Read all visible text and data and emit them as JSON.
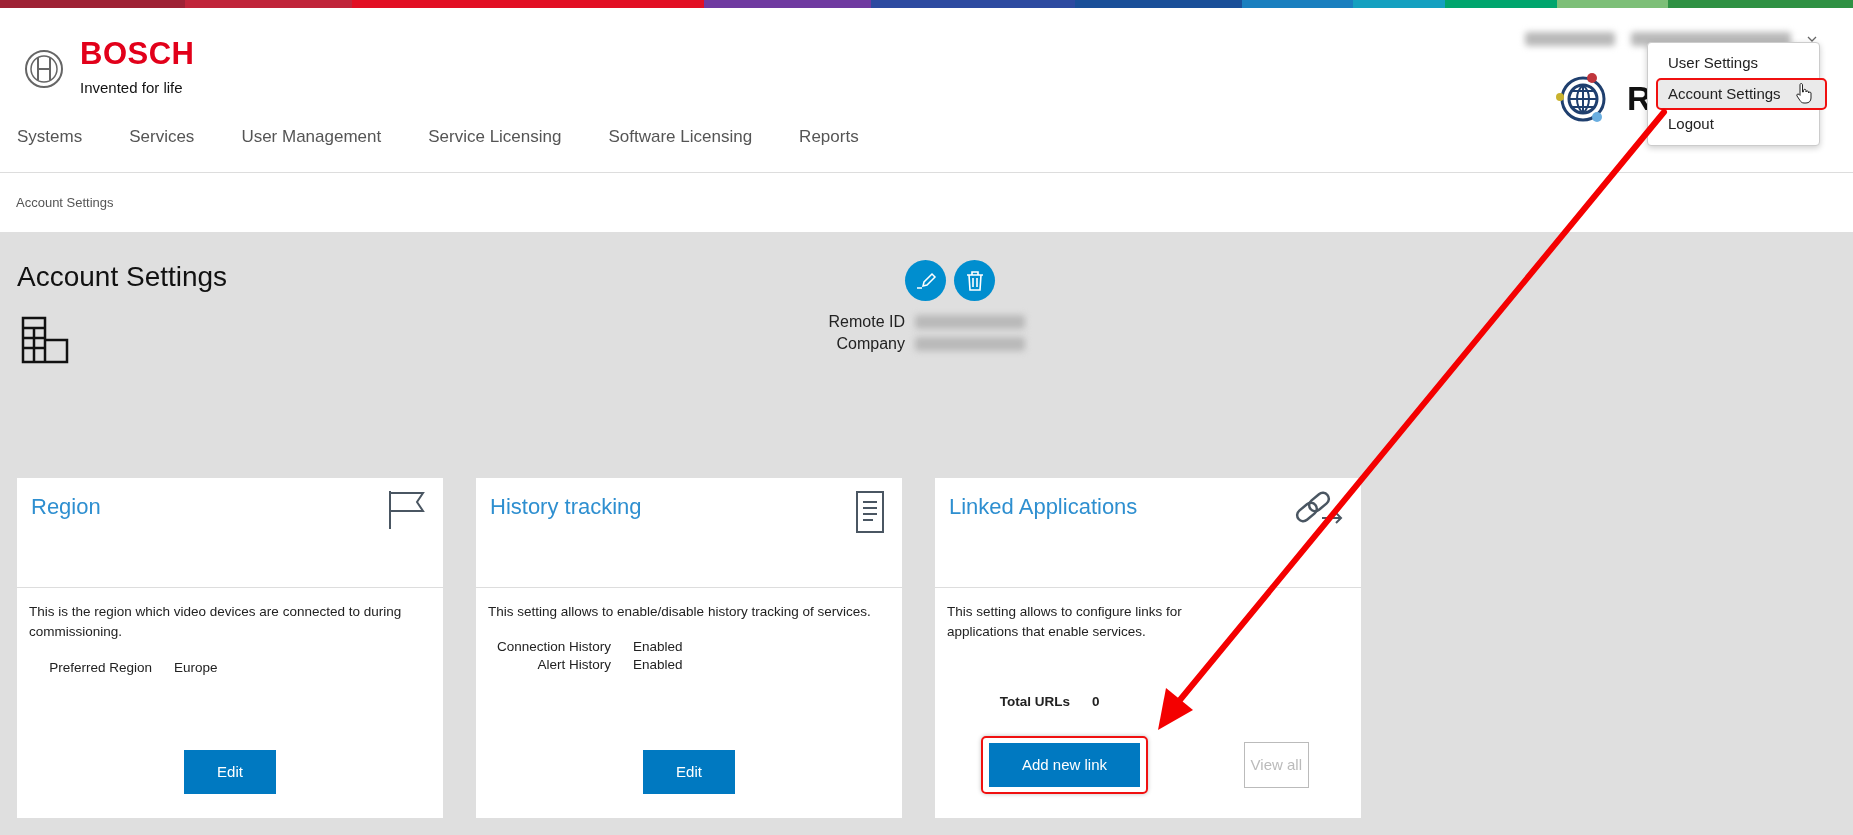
{
  "brand": {
    "name": "BOSCH",
    "tagline": "Invented for life"
  },
  "account_bar": {
    "redacted": true,
    "expanded": true
  },
  "app_logo": {
    "text": "R"
  },
  "user_menu": {
    "items": [
      {
        "label": "User Settings",
        "hovered": false,
        "highlighted": false
      },
      {
        "label": "Account Settings",
        "hovered": true,
        "highlighted": true
      },
      {
        "label": "Logout",
        "hovered": false,
        "highlighted": false
      }
    ]
  },
  "nav": [
    {
      "label": "Systems"
    },
    {
      "label": "Services"
    },
    {
      "label": "User Management"
    },
    {
      "label": "Service Licensing"
    },
    {
      "label": "Software Licensing"
    },
    {
      "label": "Reports"
    }
  ],
  "breadcrumb": [
    "Account Settings"
  ],
  "page": {
    "title": "Account Settings",
    "fields": [
      {
        "label": "Remote ID",
        "redacted": true
      },
      {
        "label": "Company",
        "redacted": true
      }
    ]
  },
  "cards": [
    {
      "title": "Region",
      "kind": "setting",
      "description": "This is the region which video devices are connected to during commissioning.",
      "rows": [
        {
          "label": "Preferred Region",
          "value": "Europe"
        }
      ],
      "buttons": [
        {
          "label": "Edit",
          "disabled": false,
          "highlighted": false
        }
      ]
    },
    {
      "title": "History tracking",
      "kind": "setting",
      "description": "This setting allows to enable/disable history tracking of services.",
      "rows": [
        {
          "label": "Connection History",
          "value": "Enabled"
        },
        {
          "label": "Alert History",
          "value": "Enabled"
        }
      ],
      "buttons": [
        {
          "label": "Edit",
          "disabled": false,
          "highlighted": false
        }
      ]
    },
    {
      "title": "Linked Applications",
      "kind": "summary",
      "description": "This setting allows to configure links for applications that enable services.",
      "rows": [
        {
          "label": "Total URLs",
          "value": "0"
        }
      ],
      "buttons": [
        {
          "label": "Add new link",
          "disabled": false,
          "highlighted": true
        },
        {
          "label": "View all",
          "disabled": true,
          "highlighted": false
        }
      ]
    }
  ],
  "annotation": {
    "kind": "arrow"
  }
}
